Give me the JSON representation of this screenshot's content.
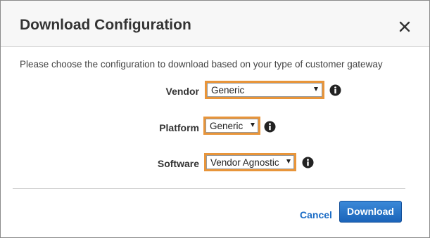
{
  "dialog": {
    "title": "Download Configuration",
    "description": "Please choose the configuration to download based on your type of customer gateway",
    "fields": [
      {
        "label": "Vendor",
        "value": "Generic"
      },
      {
        "label": "Platform",
        "value": "Generic"
      },
      {
        "label": "Software",
        "value": "Vendor Agnostic"
      }
    ],
    "cancel_label": "Cancel",
    "download_label": "Download"
  },
  "icons": {
    "close": "close-icon",
    "info": "info-icon",
    "dropdown": "chevron-down-icon"
  },
  "colors": {
    "highlight_border": "#e8953a",
    "primary_button": "#1f6fc5",
    "link": "#1a6bc5"
  }
}
